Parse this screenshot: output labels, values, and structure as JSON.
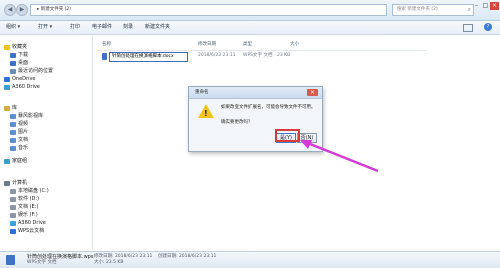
{
  "address": {
    "text": "▸ 新建文件夹 (2)",
    "back_glyph": "◀",
    "fwd_glyph": "▶"
  },
  "search": {
    "placeholder": "搜索 新建文件夹 (2)",
    "icon": "search-icon"
  },
  "window_buttons": {
    "min": "–",
    "max": "□",
    "close": "×"
  },
  "toolbar": {
    "items": [
      "组织 ▾",
      "打开 ▾",
      "打印",
      "电子邮件",
      "刻录",
      "新建文件夹"
    ],
    "help": "?"
  },
  "sidebar": {
    "items": [
      {
        "label": "收藏夹",
        "color": "#f2c31b"
      },
      {
        "label": "下载",
        "color": "#3f72c4"
      },
      {
        "label": "桌面",
        "color": "#3f72c4"
      },
      {
        "label": "最近访问的位置",
        "color": "#6d8db5"
      },
      {
        "label": "OneDrive",
        "color": "#2f6fd6"
      },
      {
        "label": "A360 Drive",
        "color": "#3da0d8"
      },
      {
        "label": "库",
        "color": "#d4a843"
      },
      {
        "label": "暴风影视库",
        "color": "#5b8fd1"
      },
      {
        "label": "视频",
        "color": "#5b8fd1"
      },
      {
        "label": "图片",
        "color": "#5b8fd1"
      },
      {
        "label": "文档",
        "color": "#5b8fd1"
      },
      {
        "label": "音乐",
        "color": "#5b8fd1"
      },
      {
        "label": "家庭组",
        "color": "#3aa0c9"
      },
      {
        "label": "计算机",
        "color": "#6a7a90"
      },
      {
        "label": "本地磁盘 (C:)",
        "color": "#8a96a6"
      },
      {
        "label": "软件 (D:)",
        "color": "#8a96a6"
      },
      {
        "label": "文档 (E:)",
        "color": "#8a96a6"
      },
      {
        "label": "娱乐 (F:)",
        "color": "#8a96a6"
      },
      {
        "label": "A360 Drive",
        "color": "#3da0d8"
      },
      {
        "label": "WPS云文档",
        "color": "#2f6fd6"
      }
    ]
  },
  "columns": [
    "名称",
    "修改日期",
    "类型",
    "大小"
  ],
  "file": {
    "name": "针筒创处理在换演格脚本.docx",
    "modified": "2018/6/23 23:11",
    "type": "WPS文字 文档",
    "size": "23 KB"
  },
  "dialog": {
    "title": "重命名",
    "close": "×",
    "warn_mark": "!",
    "line1": "如果改变文件扩展名，可能会导致文件不可用。",
    "line2": "确实要更改吗？",
    "yes": "是(Y)",
    "no": "否(N)"
  },
  "status": {
    "file": "针筒创处理在换演格脚本.wps",
    "modified": "修改日期: 2018/6/23 23:11",
    "created": "创建日期: 2018/6/23 23:11",
    "type": "WPS文字 文档",
    "size": "大小: 23.5 KB"
  },
  "accent": {
    "highlight": "#d93a3a",
    "arrow": "#d63ad6"
  }
}
